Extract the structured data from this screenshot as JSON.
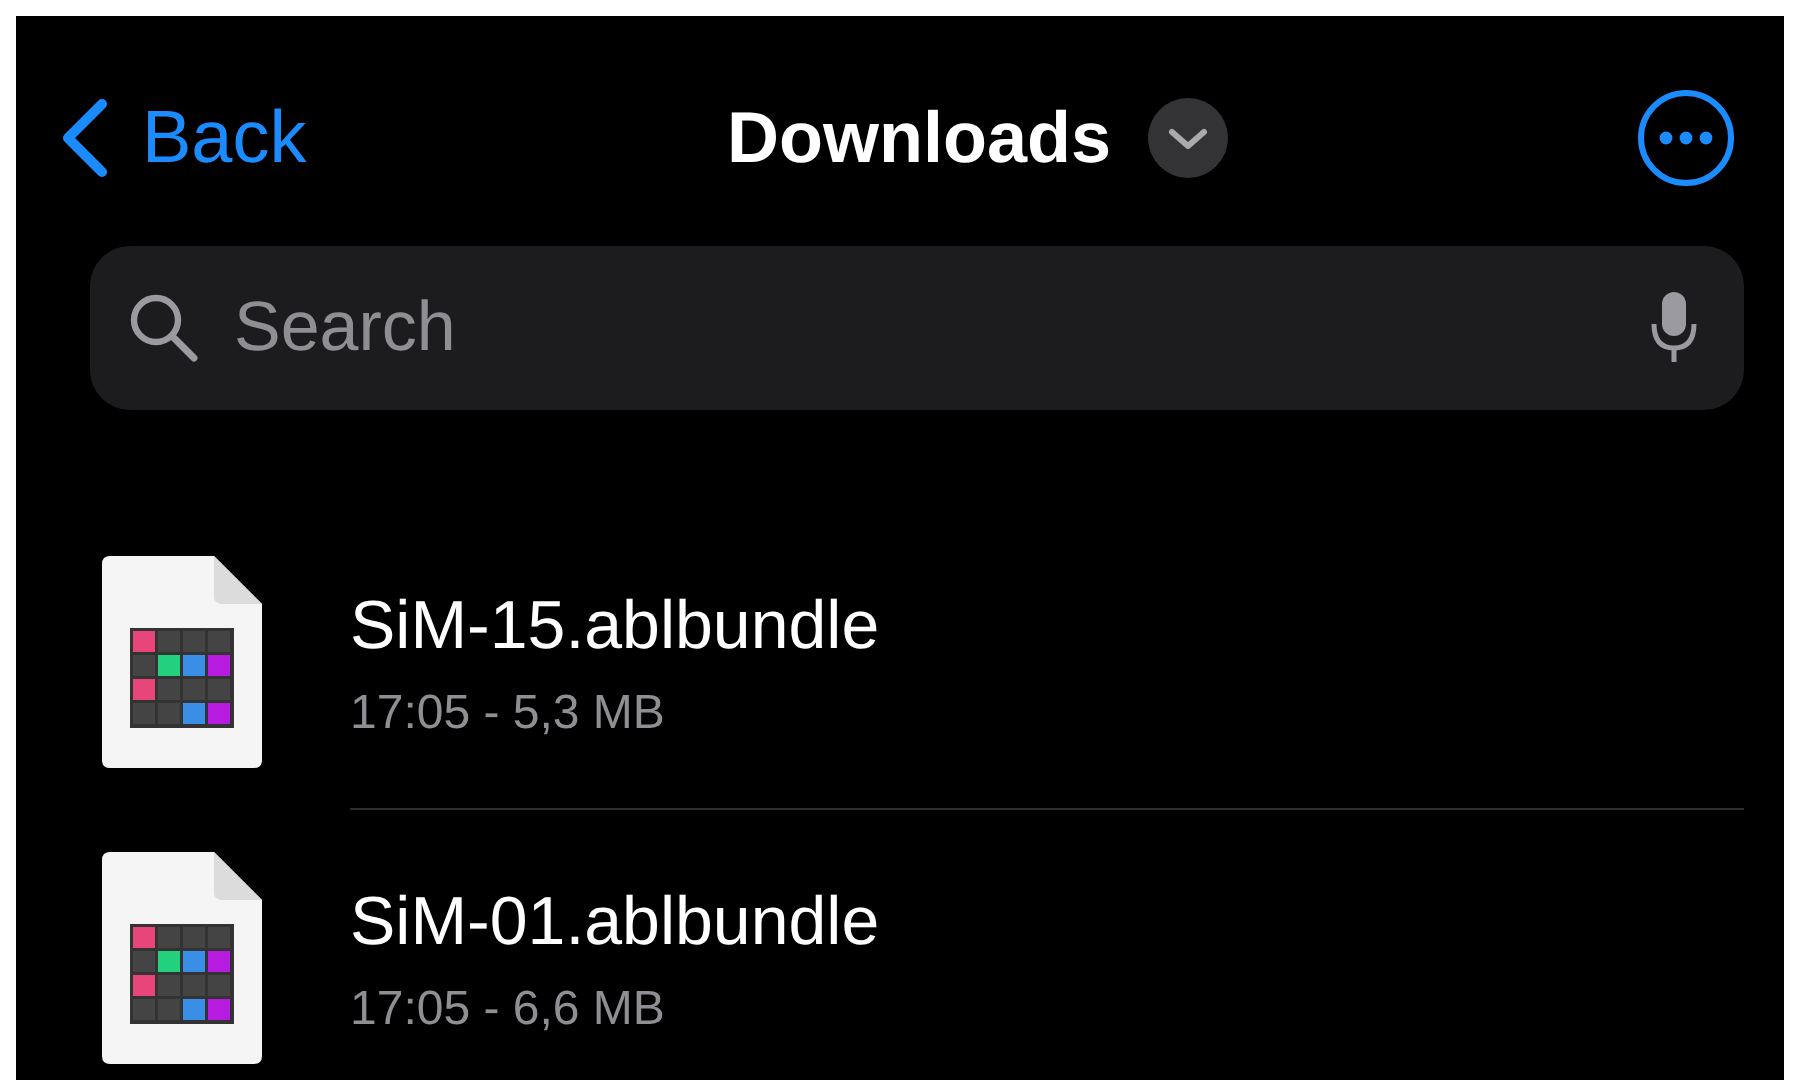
{
  "nav": {
    "back": "Back",
    "title": "Downloads"
  },
  "search": {
    "placeholder": "Search"
  },
  "files": [
    {
      "name": "SiM-15.ablbundle",
      "details": "17:05 - 5,3 MB"
    },
    {
      "name": "SiM-01.ablbundle",
      "details": "17:05 - 6,6 MB"
    }
  ]
}
